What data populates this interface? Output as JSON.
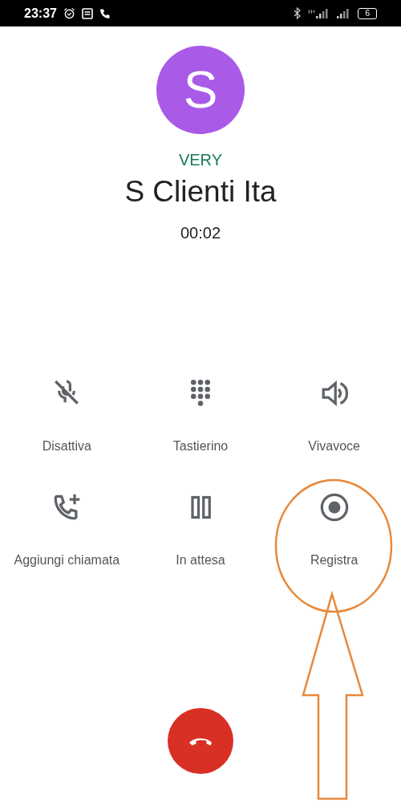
{
  "status_bar": {
    "time": "23:37",
    "network": "H+",
    "battery": "6"
  },
  "contact": {
    "initial": "S",
    "label": "VERY",
    "name": "S Clienti Ita",
    "duration": "00:02"
  },
  "actions": [
    {
      "kind": "mute",
      "label": "Disattiva"
    },
    {
      "kind": "keypad",
      "label": "Tastierino"
    },
    {
      "kind": "speaker",
      "label": "Vivavoce"
    },
    {
      "kind": "add-call",
      "label": "Aggiungi chiamata"
    },
    {
      "kind": "hold",
      "label": "In attesa"
    },
    {
      "kind": "record",
      "label": "Registra"
    }
  ]
}
